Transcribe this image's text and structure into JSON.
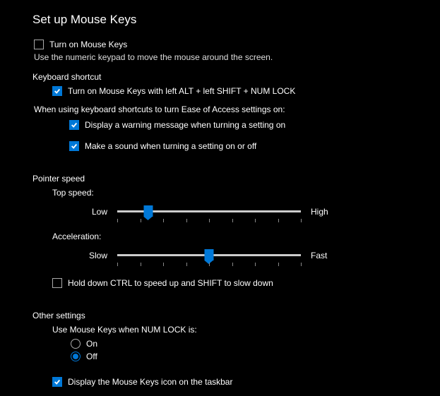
{
  "title": "Set up Mouse Keys",
  "turn_on": {
    "label": "Turn on Mouse Keys",
    "checked": false,
    "desc": "Use the numeric keypad to move the mouse around the screen."
  },
  "keyboard_shortcut": {
    "header": "Keyboard shortcut",
    "enable": {
      "label": "Turn on Mouse Keys with left ALT + left SHIFT + NUM LOCK",
      "checked": true
    },
    "intro": "When using keyboard shortcuts to turn Ease of Access settings on:",
    "warning": {
      "label": "Display a warning message when turning a setting on",
      "checked": true
    },
    "sound": {
      "label": "Make a sound when turning a setting on or off",
      "checked": true
    }
  },
  "pointer_speed": {
    "header": "Pointer speed",
    "top_speed": {
      "label": "Top speed:",
      "low": "Low",
      "high": "High",
      "value": 17,
      "min": 0,
      "max": 100
    },
    "acceleration": {
      "label": "Acceleration:",
      "low": "Slow",
      "high": "Fast",
      "value": 50,
      "min": 0,
      "max": 100
    },
    "ctrl_shift": {
      "label": "Hold down CTRL to speed up and SHIFT to slow down",
      "checked": false
    }
  },
  "other": {
    "header": "Other settings",
    "numlock_label": "Use Mouse Keys when NUM LOCK is:",
    "option_on": "On",
    "option_off": "Off",
    "selected": "off",
    "taskbar": {
      "label": "Display the Mouse Keys icon on the taskbar",
      "checked": true
    }
  }
}
